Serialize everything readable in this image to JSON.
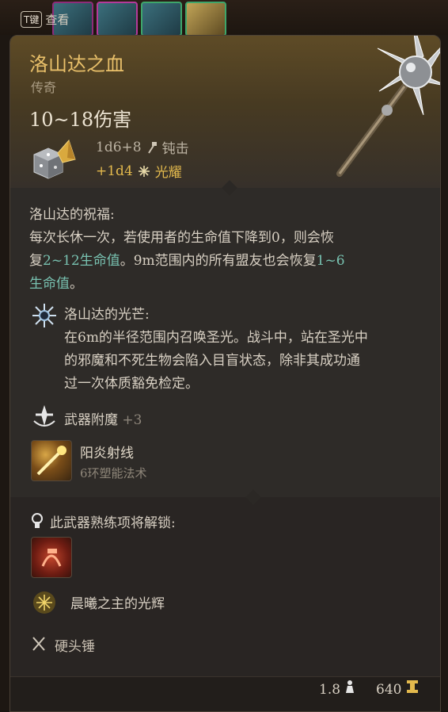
{
  "key_hint": {
    "key": "T键",
    "label": "查看"
  },
  "item": {
    "name": "洛山达之血",
    "rarity": "传奇",
    "damage": "10~18伤害",
    "damage_main": "1d6+8",
    "damage_main_type": "钝击",
    "damage_bonus": "+1d4",
    "damage_bonus_type": "光耀"
  },
  "blessing": {
    "title": "洛山达的祝福:",
    "text_a": "每次长休一次，若使用者的生命值下降到0，则会恢",
    "text_b": "复",
    "heal_self": "2~12生命值",
    "text_c": "。9m范围内的所有盟友也会恢复",
    "heal_allies_num": "1~6",
    "heal_allies_unit": "生命值",
    "text_d": "。"
  },
  "radiance": {
    "title": "洛山达的光芒:",
    "line1": "在6m的半径范围内召唤圣光。战斗中，站在圣光中",
    "line2": "的邪魔和不死生物会陷入目盲状态，除非其成功通",
    "line3": "过一次体质豁免检定。"
  },
  "enchant": {
    "label": "武器附魔",
    "value": "+3"
  },
  "spell": {
    "name": "阳炎射线",
    "level": "6环塑能法术"
  },
  "proficiency": {
    "title": "此武器熟练项将解锁:",
    "feature": "晨曦之主的光辉"
  },
  "weapon_type": "硬头锤",
  "footer": {
    "weight": "1.8",
    "price": "640"
  },
  "colors": {
    "title": "#e9c06a",
    "radiant": "#e3b94d",
    "heal": "#78c1b0"
  },
  "icons": [
    "dice-icon",
    "mace-icon",
    "blunt-icon",
    "radiant-icon",
    "sunburst-icon",
    "enchant-icon",
    "sunbeam-spell-icon",
    "proficiency-icon",
    "radiant-feature-icon",
    "weapon-type-icon",
    "weight-icon",
    "gold-icon"
  ]
}
